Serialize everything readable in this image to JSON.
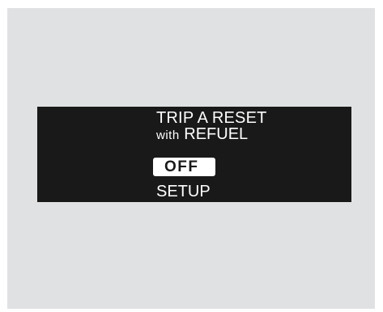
{
  "display": {
    "title": "TRIP A RESET",
    "subtitle_prefix": "with",
    "subtitle_main": "REFUEL",
    "selected_option": "OFF",
    "setup_label": "SETUP"
  },
  "colors": {
    "screen_background": "#1a1919",
    "screen_text": "#ffffff",
    "highlight_background": "#ffffff",
    "panel_background": "#e0e1e3"
  }
}
